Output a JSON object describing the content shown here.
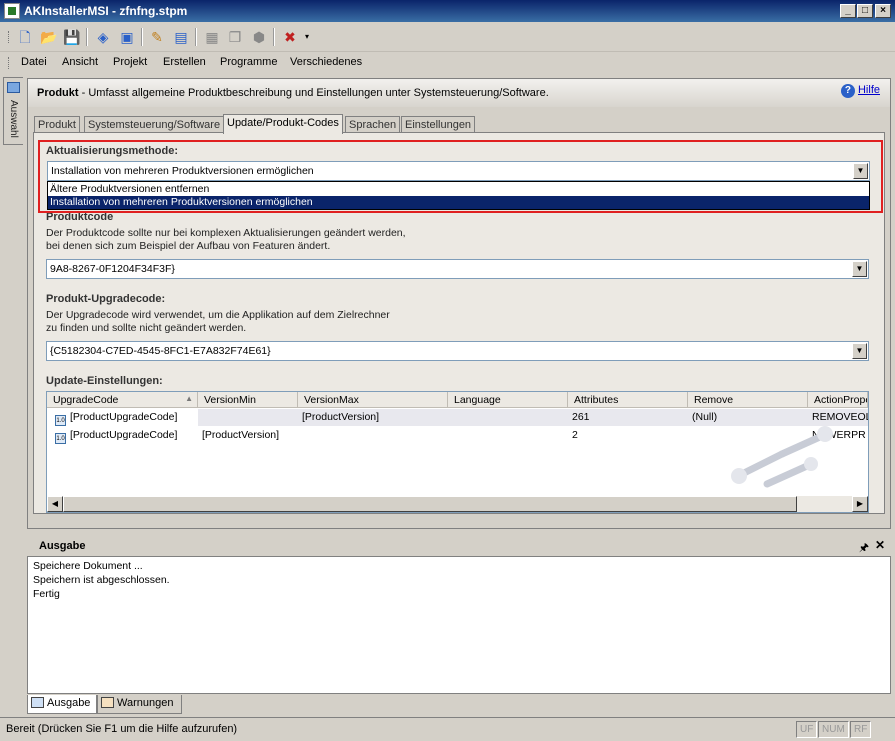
{
  "window": {
    "title": "AKInstallerMSI - zfnfng.stpm",
    "min": "_",
    "max": "□",
    "close": "×"
  },
  "menu": [
    "Datei",
    "Ansicht",
    "Projekt",
    "Erstellen",
    "Programme",
    "Verschiedenes"
  ],
  "sidebar": {
    "tab_label": "Auswahl"
  },
  "header": {
    "title": "Produkt",
    "description": " - Umfasst allgemeine Produktbeschreibung und Einstellungen unter Systemsteuerung/Software.",
    "help": "Hilfe"
  },
  "tabs": [
    "Produkt",
    "Systemsteuerung/Software",
    "Update/Produkt-Codes",
    "Sprachen",
    "Einstellungen"
  ],
  "update_method": {
    "label": "Aktualisierungsmethode:",
    "value": "Installation von mehreren Produktversionen ermöglichen",
    "options": [
      "Ältere Produktversionen entfernen",
      "Installation von mehreren Produktversionen ermöglichen"
    ]
  },
  "product_code": {
    "label": "Produktcode",
    "desc1": "Der Produktcode sollte nur bei komplexen Aktualisierungen geändert werden,",
    "desc2": "bei denen sich zum Beispiel der Aufbau von Featuren ändert.",
    "value": "9A8-8267-0F1204F34F3F}"
  },
  "upgrade_code": {
    "label": "Produkt-Upgradecode:",
    "desc1": "Der Upgradecode wird verwendet, um die Applikation auf dem Zielrechner",
    "desc2": "zu finden und sollte nicht geändert werden.",
    "value": "{C5182304-C7ED-4545-8FC1-E7A832F74E61}"
  },
  "update_settings": {
    "label": "Update-Einstellungen:",
    "columns": [
      "UpgradeCode",
      "VersionMin",
      "VersionMax",
      "Language",
      "Attributes",
      "Remove",
      "ActionPrope"
    ],
    "rows": [
      [
        "[ProductUpgradeCode]",
        "",
        "[ProductVersion]",
        "",
        "261",
        "(Null)",
        "REMOVEOL"
      ],
      [
        "[ProductUpgradeCode]",
        "[ProductVersion]",
        "",
        "",
        "2",
        "",
        "NEWERPR"
      ]
    ],
    "row_icon": "1.0"
  },
  "output": {
    "title": "Ausgabe",
    "lines": [
      "Speichere Dokument ...",
      "Speichern ist abgeschlossen.",
      "Fertig"
    ]
  },
  "bottom_tabs": [
    "Ausgabe",
    "Warnungen"
  ],
  "status": {
    "text": "Bereit (Drücken Sie F1 um die Hilfe aufzurufen)",
    "indicators": [
      "UF",
      "NUM",
      "RF"
    ]
  }
}
